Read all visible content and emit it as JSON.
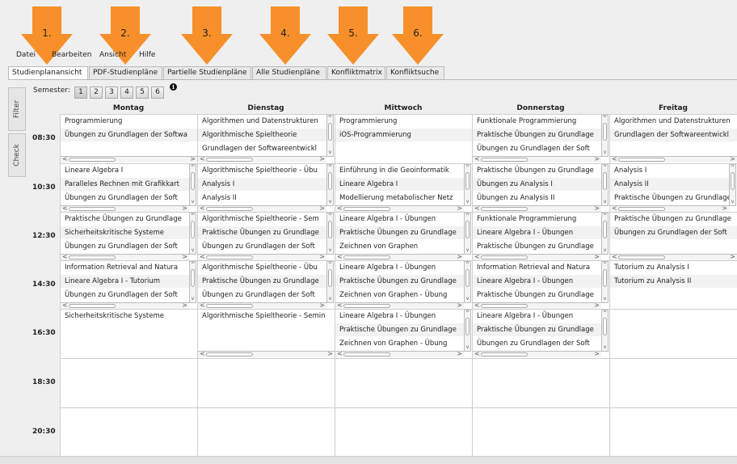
{
  "annotations": [
    "1.",
    "2.",
    "3.",
    "4.",
    "5.",
    "6."
  ],
  "menu": [
    "Datei",
    "Bearbeiten",
    "Ansicht",
    "Hilfe"
  ],
  "tabs": [
    "Studienplanansicht",
    "PDF-Studienpläne",
    "Partielle Studienpläne",
    "Alle Studienpläne",
    "Konfliktmatrix",
    "Konfliktsuche"
  ],
  "side_tabs": [
    "Filter",
    "Check"
  ],
  "semester": {
    "label": "Semester:",
    "options": [
      "1",
      "2",
      "3",
      "4",
      "5",
      "6"
    ],
    "selected": "1"
  },
  "info_icon": "i",
  "days": [
    "Montag",
    "Dienstag",
    "Mittwoch",
    "Donnerstag",
    "Freitag"
  ],
  "times": [
    "08:30",
    "10:30",
    "12:30",
    "14:30",
    "16:30",
    "18:30",
    "20:30"
  ],
  "slots": [
    [
      [
        "Programmierung",
        "Übungen zu Grundlagen der Softwa"
      ],
      [
        "Algorithmen und Datenstrukturen",
        "Algorithmische Spieltheorie",
        "Grundlagen der Softwareentwickl"
      ],
      [
        "Programmierung",
        "iOS-Programmierung"
      ],
      [
        "Funktionale Programmierung",
        "Praktische Übungen zu Grundlage",
        "Übungen zu Grundlagen der Soft"
      ],
      [
        "Algorithmen und Datenstrukturen",
        "Grundlagen der Softwareentwickl"
      ]
    ],
    [
      [
        "Lineare Algebra I",
        "Paralleles Rechnen mit Grafikkart",
        "Übungen zu Grundlagen der Soft"
      ],
      [
        "Algorithmische Spieltheorie - Übu",
        "Analysis I",
        "Analysis II"
      ],
      [
        "Einführung in die Geoinformatik",
        "Lineare Algebra I",
        "Modellierung metabolischer Netz"
      ],
      [
        "Praktische Übungen zu Grundlage",
        "Übungen zu Analysis I",
        "Übungen zu Analysis II"
      ],
      [
        "Analysis I",
        "Analysis II",
        "Praktische Übungen zu Grundlage"
      ]
    ],
    [
      [
        "Praktische Übungen zu Grundlage",
        "Sicherheitskritische Systeme",
        "Übungen zu Grundlagen der Soft"
      ],
      [
        "Algorithmische Spieltheorie - Sem",
        "Praktische Übungen zu Grundlage",
        "Übungen zu Grundlagen der Soft"
      ],
      [
        "Lineare Algebra I - Übungen",
        "Praktische Übungen zu Grundlage",
        "Zeichnen von Graphen"
      ],
      [
        "Funktionale Programmierung",
        "Lineare Algebra I - Übungen",
        "Praktische Übungen zu Grundlage"
      ],
      [
        "Praktische Übungen zu Grundlage",
        "Übungen zu Grundlagen der Soft"
      ]
    ],
    [
      [
        "Information Retrieval and Natura",
        "Lineare Algebra I - Tutorium",
        "Übungen zu Grundlagen der Soft"
      ],
      [
        "Algorithmische Spieltheorie - Übu",
        "Praktische Übungen zu Grundlage",
        "Übungen zu Grundlagen der Soft"
      ],
      [
        "Lineare Algebra I - Übungen",
        "Praktische Übungen zu Grundlage",
        "Zeichnen von Graphen - Übung"
      ],
      [
        "Information Retrieval and Natura",
        "Lineare Algebra I - Übungen",
        "Praktische Übungen zu Grundlage"
      ],
      [
        "Tutorium zu Analysis I",
        "Tutorium zu Analysis II"
      ]
    ],
    [
      [
        "Sicherheitskritische Systeme"
      ],
      [
        "Algorithmische Spieltheorie - Semin"
      ],
      [
        "Lineare Algebra I - Übungen",
        "Praktische Übungen zu Grundlage",
        "Zeichnen von Graphen - Übung"
      ],
      [
        "Lineare Algebra I - Übungen",
        "Praktische Übungen zu Grundlage",
        "Übungen zu Grundlagen der Soft"
      ],
      []
    ],
    [
      [],
      [],
      [],
      [],
      []
    ],
    [
      [],
      [],
      [],
      [],
      []
    ]
  ]
}
